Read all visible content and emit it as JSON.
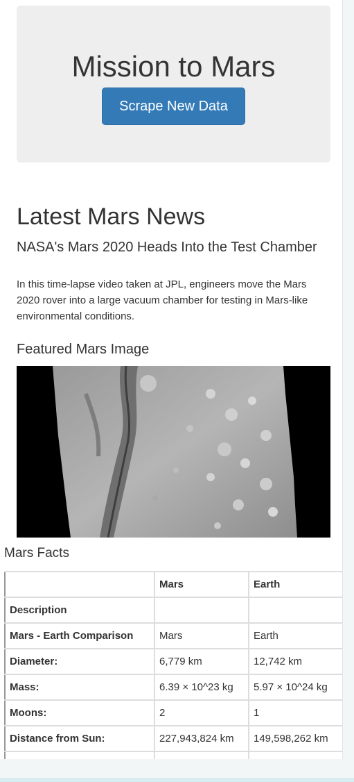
{
  "jumbotron": {
    "title": "Mission to Mars",
    "scrape_button": "Scrape New Data"
  },
  "news": {
    "heading": "Latest Mars News",
    "title": "NASA's Mars 2020 Heads Into the Test Chamber",
    "body": "In this time-lapse video taken at JPL, engineers move the Mars 2020 rover into a large vacuum chamber for testing in Mars-like environmental conditions."
  },
  "featured": {
    "heading": "Featured Mars Image"
  },
  "facts": {
    "heading": "Mars Facts",
    "columns": [
      "",
      "Mars",
      "Earth"
    ],
    "rows": [
      [
        "Description",
        "",
        ""
      ],
      [
        "Mars - Earth Comparison",
        "Mars",
        "Earth"
      ],
      [
        "Diameter:",
        "6,779 km",
        "12,742 km"
      ],
      [
        "Mass:",
        "6.39 × 10^23 kg",
        "5.97 × 10^24 kg"
      ],
      [
        "Moons:",
        "2",
        "1"
      ],
      [
        "Distance from Sun:",
        "227,943,824 km",
        "149,598,262 km"
      ],
      [
        "",
        "",
        ""
      ]
    ]
  },
  "colors": {
    "primary_button": "#337ab7",
    "jumbotron_bg": "#eeeeee"
  }
}
